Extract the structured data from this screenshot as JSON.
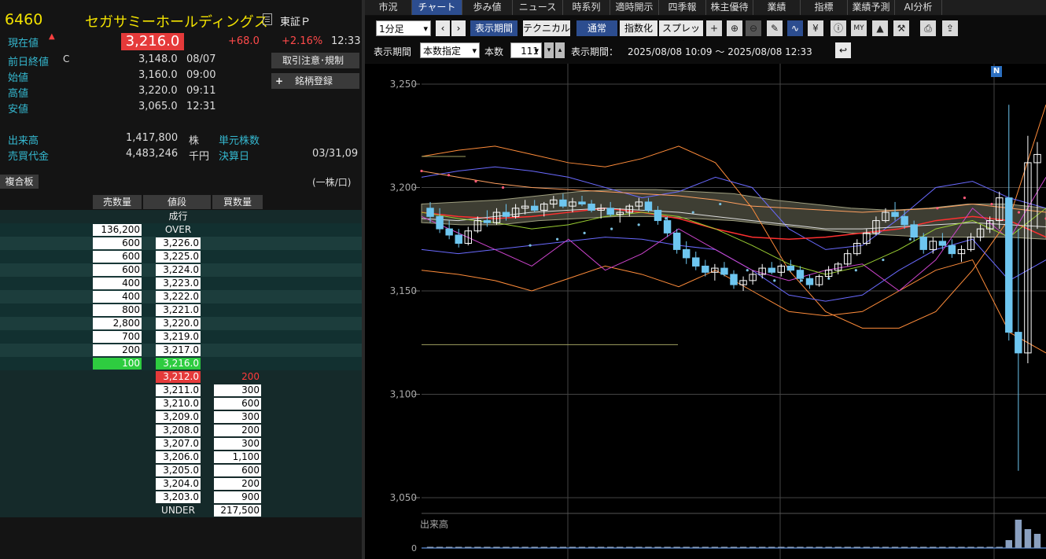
{
  "quote": {
    "code": "6460",
    "name": "セガサミーホールディングス",
    "market": "東証Ｐ",
    "current_label": "現在値",
    "current_price": "3,216.0",
    "change": "+68.0",
    "change_pct": "+2.16%",
    "current_time": "12:33",
    "prev_close_label": "前日終値",
    "prev_close_flag": "C",
    "prev_close": "3,148.0",
    "prev_close_date": "08/07",
    "open_label": "始値",
    "open": "3,160.0",
    "open_time": "09:00",
    "high_label": "高値",
    "high": "3,220.0",
    "high_time": "09:11",
    "low_label": "安値",
    "low": "3,065.0",
    "low_time": "12:31",
    "volume_label": "出来高",
    "volume": "1,417,800",
    "volume_unit": "株",
    "unit_shares_label": "単元株数",
    "turnover_label": "売買代金",
    "turnover": "4,483,246",
    "turnover_unit": "千円",
    "settlement_label": "決算日",
    "settlement": "03/31,09",
    "order_notice_button": "取引注意･規制",
    "register_button": "銘柄登録",
    "multi_board": "複合板",
    "per_share": "(一株/口)"
  },
  "orderbook": {
    "headers": [
      "売数量",
      "値段",
      "買数量"
    ],
    "market_order": "成行",
    "over_label": "OVER",
    "over_qty": "136,200",
    "under_label": "UNDER",
    "under_qty": "217,500",
    "asks": [
      {
        "qty": "600",
        "price": "3,226.0"
      },
      {
        "qty": "600",
        "price": "3,225.0"
      },
      {
        "qty": "600",
        "price": "3,224.0"
      },
      {
        "qty": "400",
        "price": "3,223.0"
      },
      {
        "qty": "400",
        "price": "3,222.0"
      },
      {
        "qty": "800",
        "price": "3,221.0"
      },
      {
        "qty": "2,800",
        "price": "3,220.0"
      },
      {
        "qty": "700",
        "price": "3,219.0"
      },
      {
        "qty": "200",
        "price": "3,217.0"
      },
      {
        "qty": "100",
        "price": "3,216.0",
        "highlight": "green"
      }
    ],
    "bids": [
      {
        "qty": "200",
        "price": "3,212.0",
        "highlight": "red"
      },
      {
        "qty": "300",
        "price": "3,211.0"
      },
      {
        "qty": "600",
        "price": "3,210.0"
      },
      {
        "qty": "300",
        "price": "3,209.0"
      },
      {
        "qty": "200",
        "price": "3,208.0"
      },
      {
        "qty": "300",
        "price": "3,207.0"
      },
      {
        "qty": "1,100",
        "price": "3,206.0"
      },
      {
        "qty": "600",
        "price": "3,205.0"
      },
      {
        "qty": "200",
        "price": "3,204.0"
      },
      {
        "qty": "900",
        "price": "3,203.0"
      }
    ]
  },
  "tabs": [
    "市況",
    "チャート",
    "歩み値",
    "ニュース",
    "時系列",
    "適時開示",
    "四季報",
    "株主優待",
    "業績",
    "指標",
    "業績予測",
    "AI分析"
  ],
  "active_tab": 1,
  "chart_toolbar": {
    "interval": "1分足",
    "period_button": "表示期間",
    "technical_button": "テクニカル",
    "normal_button": "通常",
    "index_button": "指数化",
    "spread_button": "スプレッド",
    "period_label": "表示期間",
    "period_mode": "本数指定",
    "bars_label": "本数",
    "bars": "111",
    "range_label": "表示期間：",
    "range": "2025/08/08 10:09 〜 2025/08/08 12:33",
    "icons": [
      "crosshair-icon",
      "zoom-in-icon",
      "zoom-out-icon",
      "pencil-icon",
      "line-draw-icon",
      "yen-icon",
      "info-icon",
      "my-indicator-icon",
      "area-chart-icon",
      "wrench-icon",
      "print-icon",
      "export-icon"
    ]
  },
  "chart_data": {
    "type": "candlestick",
    "y_ticks": [
      "3,250",
      "3,200",
      "3,150",
      "3,100",
      "3,050"
    ],
    "y_values": [
      3250,
      3200,
      3150,
      3100,
      3050
    ],
    "ylim": [
      3050,
      3250
    ],
    "volume_label": "出来高",
    "volume_ticks": [
      "0"
    ],
    "marker": "N",
    "candles": [
      [
        3190,
        3193,
        3183,
        3186
      ],
      [
        3186,
        3190,
        3178,
        3180
      ],
      [
        3180,
        3184,
        3175,
        3177
      ],
      [
        3177,
        3180,
        3171,
        3173
      ],
      [
        3173,
        3181,
        3172,
        3179
      ],
      [
        3179,
        3186,
        3178,
        3184
      ],
      [
        3184,
        3189,
        3181,
        3183
      ],
      [
        3183,
        3190,
        3182,
        3188
      ],
      [
        3188,
        3192,
        3184,
        3186
      ],
      [
        3186,
        3192,
        3185,
        3190
      ],
      [
        3190,
        3194,
        3187,
        3191
      ],
      [
        3191,
        3194,
        3188,
        3189
      ],
      [
        3189,
        3193,
        3186,
        3192
      ],
      [
        3192,
        3196,
        3190,
        3194
      ],
      [
        3194,
        3197,
        3190,
        3191
      ],
      [
        3191,
        3195,
        3188,
        3193
      ],
      [
        3193,
        3196,
        3191,
        3192
      ],
      [
        3192,
        3194,
        3188,
        3189
      ],
      [
        3189,
        3192,
        3185,
        3190
      ],
      [
        3190,
        3193,
        3186,
        3187
      ],
      [
        3187,
        3190,
        3183,
        3188
      ],
      [
        3188,
        3192,
        3186,
        3191
      ],
      [
        3191,
        3195,
        3189,
        3193
      ],
      [
        3193,
        3195,
        3188,
        3189
      ],
      [
        3189,
        3191,
        3182,
        3184
      ],
      [
        3184,
        3186,
        3176,
        3178
      ],
      [
        3178,
        3180,
        3168,
        3170
      ],
      [
        3170,
        3174,
        3163,
        3166
      ],
      [
        3166,
        3169,
        3160,
        3162
      ],
      [
        3162,
        3165,
        3157,
        3159
      ],
      [
        3159,
        3163,
        3155,
        3161
      ],
      [
        3161,
        3164,
        3157,
        3158
      ],
      [
        3158,
        3160,
        3151,
        3153
      ],
      [
        3153,
        3157,
        3150,
        3155
      ],
      [
        3155,
        3160,
        3153,
        3158
      ],
      [
        3158,
        3163,
        3156,
        3161
      ],
      [
        3161,
        3164,
        3158,
        3159
      ],
      [
        3159,
        3163,
        3157,
        3162
      ],
      [
        3162,
        3165,
        3159,
        3160
      ],
      [
        3160,
        3162,
        3154,
        3156
      ],
      [
        3156,
        3158,
        3151,
        3153
      ],
      [
        3153,
        3158,
        3152,
        3157
      ],
      [
        3157,
        3162,
        3156,
        3160
      ],
      [
        3160,
        3164,
        3158,
        3163
      ],
      [
        3163,
        3170,
        3162,
        3168
      ],
      [
        3168,
        3175,
        3167,
        3173
      ],
      [
        3173,
        3180,
        3172,
        3178
      ],
      [
        3178,
        3186,
        3177,
        3184
      ],
      [
        3184,
        3190,
        3183,
        3188
      ],
      [
        3188,
        3193,
        3184,
        3186
      ],
      [
        3186,
        3189,
        3180,
        3182
      ],
      [
        3182,
        3184,
        3174,
        3176
      ],
      [
        3176,
        3178,
        3168,
        3170
      ],
      [
        3170,
        3176,
        3168,
        3174
      ],
      [
        3174,
        3178,
        3170,
        3172
      ],
      [
        3172,
        3175,
        3166,
        3168
      ],
      [
        3168,
        3172,
        3164,
        3170
      ],
      [
        3170,
        3178,
        3169,
        3176
      ],
      [
        3176,
        3182,
        3174,
        3180
      ],
      [
        3180,
        3186,
        3178,
        3184
      ],
      [
        3184,
        3198,
        3180,
        3195
      ],
      [
        3195,
        3240,
        3126,
        3130
      ],
      [
        3130,
        3180,
        3063,
        3120
      ],
      [
        3120,
        3225,
        3115,
        3212
      ],
      [
        3212,
        3222,
        3180,
        3216
      ]
    ]
  }
}
